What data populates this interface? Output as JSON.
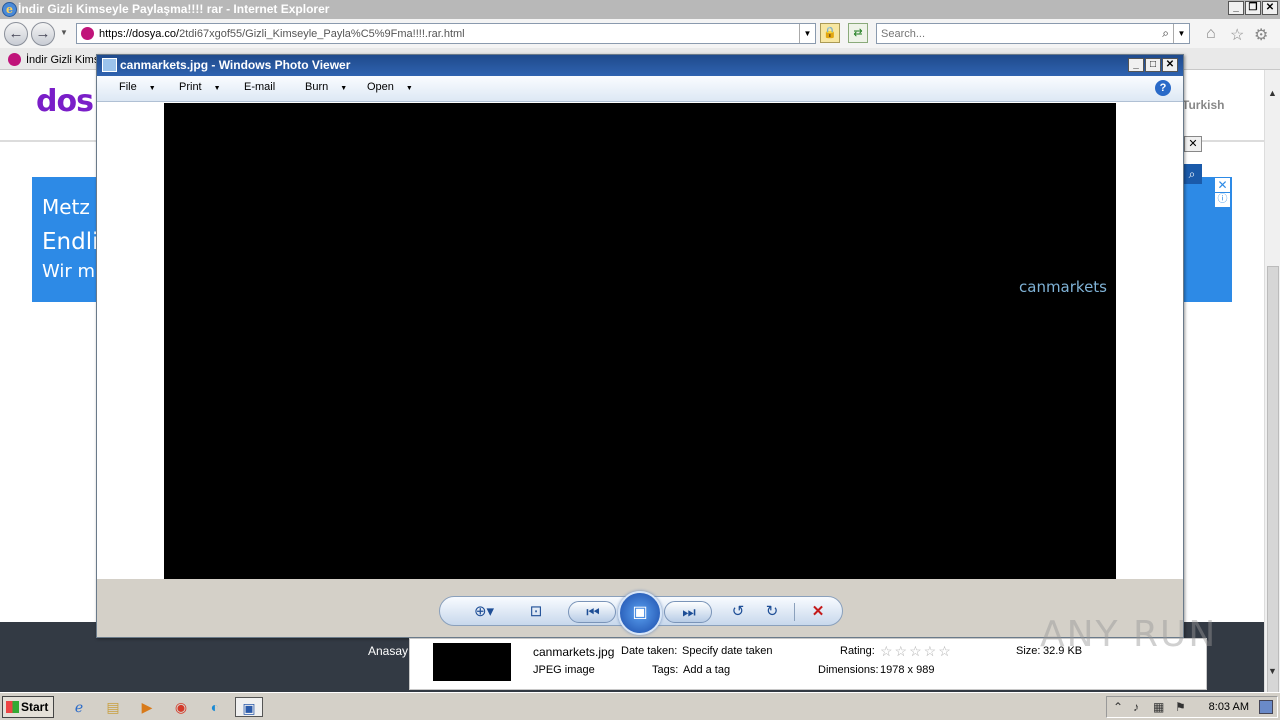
{
  "ie": {
    "title": "İndir Gizli Kimseyle Paylaşma!!!! rar - Internet Explorer",
    "url_host": "https://dosya.co/",
    "url_path": "2tdi67xgof55/Gizli_Kimseyle_Payla%C5%9Fma!!!!.rar.html",
    "search_placeholder": "Search...",
    "tab_label": "İndir Gizli Kimseyle Paylaşma!!!! rar"
  },
  "page": {
    "logo": "dos",
    "language": "Turkish",
    "ad_line1": "Metz",
    "ad_line2": "Endli",
    "ad_line3": "Wir m",
    "footer_nav": "Anasay"
  },
  "viewer": {
    "title": "canmarkets.jpg - Windows Photo Viewer",
    "menu": [
      "File",
      "Print",
      "E-mail",
      "Burn",
      "Open"
    ],
    "image_text": "canmarkets"
  },
  "details": {
    "filename": "canmarkets.jpg",
    "filetype": "JPEG image",
    "date_taken_label": "Date taken:",
    "date_taken_value": "Specify date taken",
    "tags_label": "Tags:",
    "tags_value": "Add a tag",
    "rating_label": "Rating:",
    "rating_value": 0,
    "rating_max": 5,
    "dimensions_label": "Dimensions:",
    "dimensions_value": "1978 x 989",
    "size_label": "Size:",
    "size_value": "32.9 KB"
  },
  "watermark": "ANY RUN",
  "taskbar": {
    "start_label": "Start",
    "clock": "8:03 AM"
  }
}
